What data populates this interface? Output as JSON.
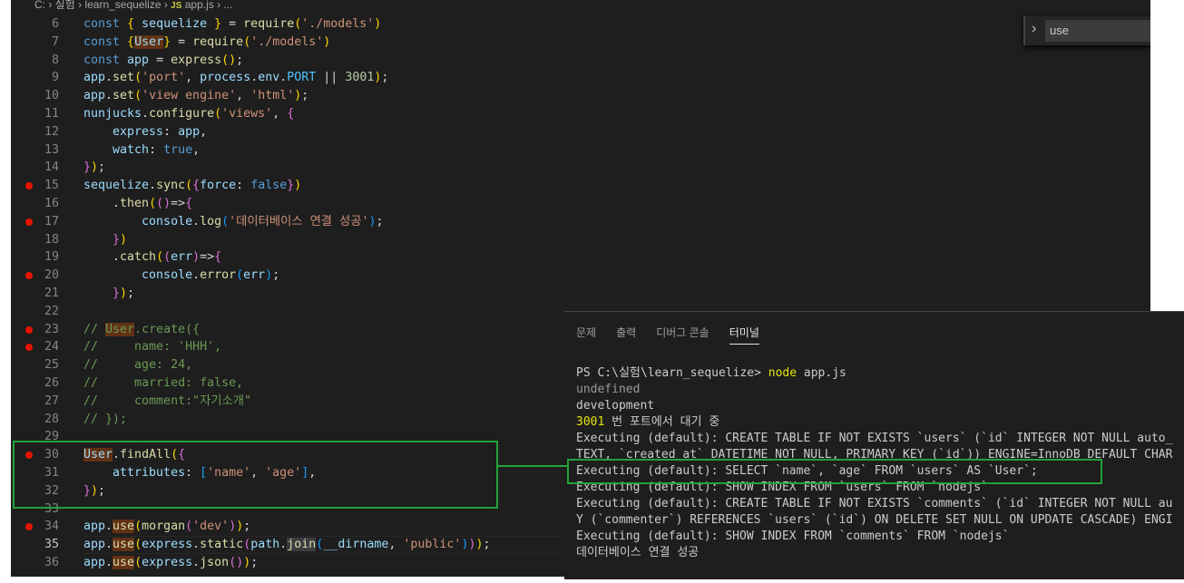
{
  "breadcrumb": {
    "parts": [
      "C:",
      "실험",
      "learn_sequelize"
    ],
    "file_icon": "JS",
    "file": "app.js",
    "ellipsis": "..."
  },
  "find_widget": {
    "toggle_icon": "chevron-right-icon",
    "value": "use"
  },
  "editor": {
    "lines": [
      {
        "n": "6",
        "t": [
          [
            "const ",
            "k"
          ],
          [
            "{",
            "b1"
          ],
          [
            " sequelize ",
            "v"
          ],
          [
            "}",
            "b1"
          ],
          [
            " = ",
            ""
          ],
          [
            "require",
            "f"
          ],
          [
            "(",
            "b1"
          ],
          [
            "'./models'",
            "s"
          ],
          [
            ")",
            "b1"
          ]
        ]
      },
      {
        "n": "7",
        "t": [
          [
            "const ",
            "k"
          ],
          [
            "{",
            "b1"
          ],
          [
            "User",
            "v hl"
          ],
          [
            "}",
            "b1"
          ],
          [
            " = ",
            ""
          ],
          [
            "require",
            "f"
          ],
          [
            "(",
            "b1"
          ],
          [
            "'./models'",
            "s"
          ],
          [
            ")",
            "b1"
          ]
        ]
      },
      {
        "n": "8",
        "t": [
          [
            "const ",
            "k"
          ],
          [
            "app",
            "v"
          ],
          [
            " = ",
            ""
          ],
          [
            "express",
            "f"
          ],
          [
            "()",
            "b1"
          ],
          [
            ";",
            ""
          ]
        ]
      },
      {
        "n": "9",
        "t": [
          [
            "app",
            "v"
          ],
          [
            ".",
            ""
          ],
          [
            "set",
            "f"
          ],
          [
            "(",
            "b1"
          ],
          [
            "'port'",
            "s"
          ],
          [
            ", ",
            ""
          ],
          [
            "process",
            "v"
          ],
          [
            ".",
            ""
          ],
          [
            "env",
            "v"
          ],
          [
            ".",
            ""
          ],
          [
            "PORT",
            "cn"
          ],
          [
            " || ",
            ""
          ],
          [
            "3001",
            "n"
          ],
          [
            ")",
            "b1"
          ],
          [
            ";",
            ""
          ]
        ]
      },
      {
        "n": "10",
        "t": [
          [
            "app",
            "v"
          ],
          [
            ".",
            ""
          ],
          [
            "set",
            "f"
          ],
          [
            "(",
            "b1"
          ],
          [
            "'view engine'",
            "s"
          ],
          [
            ", ",
            ""
          ],
          [
            "'html'",
            "s"
          ],
          [
            ")",
            "b1"
          ],
          [
            ";",
            ""
          ]
        ]
      },
      {
        "n": "11",
        "t": [
          [
            "nunjucks",
            "v"
          ],
          [
            ".",
            ""
          ],
          [
            "configure",
            "f"
          ],
          [
            "(",
            "b1"
          ],
          [
            "'views'",
            "s"
          ],
          [
            ", ",
            ""
          ],
          [
            "{",
            "b2"
          ]
        ]
      },
      {
        "n": "12",
        "t": [
          [
            "    express",
            "v"
          ],
          [
            ": ",
            ""
          ],
          [
            "app",
            "v"
          ],
          [
            ",",
            ""
          ]
        ]
      },
      {
        "n": "13",
        "t": [
          [
            "    watch",
            "v"
          ],
          [
            ": ",
            ""
          ],
          [
            "true",
            "k"
          ],
          [
            ",",
            ""
          ]
        ]
      },
      {
        "n": "14",
        "t": [
          [
            "}",
            "b2"
          ],
          [
            ")",
            "b1"
          ],
          [
            ";",
            ""
          ]
        ]
      },
      {
        "n": "15",
        "bp": true,
        "t": [
          [
            "sequelize",
            "v"
          ],
          [
            ".",
            ""
          ],
          [
            "sync",
            "f"
          ],
          [
            "(",
            "b1"
          ],
          [
            "{",
            "b2"
          ],
          [
            "force",
            "v"
          ],
          [
            ": ",
            ""
          ],
          [
            "false",
            "k"
          ],
          [
            "}",
            "b2"
          ],
          [
            ")",
            "b1"
          ]
        ]
      },
      {
        "n": "16",
        "t": [
          [
            "    .",
            ""
          ],
          [
            "then",
            "f"
          ],
          [
            "(",
            "b1"
          ],
          [
            "()",
            "b2"
          ],
          [
            "=>",
            ""
          ],
          [
            "{",
            "b2"
          ]
        ]
      },
      {
        "n": "17",
        "bp": true,
        "t": [
          [
            "        console",
            "v"
          ],
          [
            ".",
            ""
          ],
          [
            "log",
            "f"
          ],
          [
            "(",
            "b3"
          ],
          [
            "'데이터베이스 연결 성공'",
            "s"
          ],
          [
            ")",
            "b3"
          ],
          [
            ";",
            ""
          ]
        ]
      },
      {
        "n": "18",
        "t": [
          [
            "    ",
            ""
          ],
          [
            "}",
            "b2"
          ],
          [
            ")",
            "b1"
          ]
        ]
      },
      {
        "n": "19",
        "t": [
          [
            "    .",
            ""
          ],
          [
            "catch",
            "f"
          ],
          [
            "(",
            "b1"
          ],
          [
            "(",
            "b2"
          ],
          [
            "err",
            "v"
          ],
          [
            ")",
            "b2"
          ],
          [
            "=>",
            ""
          ],
          [
            "{",
            "b2"
          ]
        ]
      },
      {
        "n": "20",
        "bp": true,
        "t": [
          [
            "        console",
            "v"
          ],
          [
            ".",
            ""
          ],
          [
            "error",
            "f"
          ],
          [
            "(",
            "b3"
          ],
          [
            "err",
            "v"
          ],
          [
            ")",
            "b3"
          ],
          [
            ";",
            ""
          ]
        ]
      },
      {
        "n": "21",
        "t": [
          [
            "    ",
            ""
          ],
          [
            "}",
            "b2"
          ],
          [
            ")",
            "b1"
          ],
          [
            ";",
            ""
          ]
        ]
      },
      {
        "n": "22",
        "t": []
      },
      {
        "n": "23",
        "bp": true,
        "t": [
          [
            "// ",
            "c"
          ],
          [
            "User",
            "c hl"
          ],
          [
            ".create({",
            "c"
          ]
        ]
      },
      {
        "n": "24",
        "bp": true,
        "t": [
          [
            "//     name: 'HHH',",
            "c"
          ]
        ]
      },
      {
        "n": "25",
        "t": [
          [
            "//     age: 24,",
            "c"
          ]
        ]
      },
      {
        "n": "26",
        "t": [
          [
            "//     married: false,",
            "c"
          ]
        ]
      },
      {
        "n": "27",
        "t": [
          [
            "//     comment:\"자기소개\"",
            "c"
          ]
        ]
      },
      {
        "n": "28",
        "t": [
          [
            "// });",
            "c"
          ]
        ]
      },
      {
        "n": "29",
        "t": []
      },
      {
        "n": "30",
        "bp": true,
        "t": [
          [
            "User",
            "v hl"
          ],
          [
            ".",
            ""
          ],
          [
            "findAll",
            "f"
          ],
          [
            "(",
            "b1"
          ],
          [
            "{",
            "b2"
          ]
        ]
      },
      {
        "n": "31",
        "t": [
          [
            "    attributes",
            "v"
          ],
          [
            ": ",
            ""
          ],
          [
            "[",
            "b3"
          ],
          [
            "'name'",
            "s"
          ],
          [
            ", ",
            ""
          ],
          [
            "'age'",
            "s"
          ],
          [
            "]",
            "b3"
          ],
          [
            ",",
            ""
          ]
        ]
      },
      {
        "n": "32",
        "t": [
          [
            "}",
            "b2"
          ],
          [
            ")",
            "b1"
          ],
          [
            ";",
            ""
          ]
        ]
      },
      {
        "n": "33",
        "t": []
      },
      {
        "n": "34",
        "bp": true,
        "t": [
          [
            "app",
            "v"
          ],
          [
            ".",
            ""
          ],
          [
            "use",
            "f hl"
          ],
          [
            "(",
            "b1"
          ],
          [
            "morgan",
            "f"
          ],
          [
            "(",
            "b2"
          ],
          [
            "'dev'",
            "s"
          ],
          [
            ")",
            "b2"
          ],
          [
            ")",
            "b1"
          ],
          [
            ";",
            ""
          ]
        ]
      },
      {
        "n": "35",
        "cur": true,
        "t": [
          [
            "app",
            "v"
          ],
          [
            ".",
            ""
          ],
          [
            "use",
            "f hl"
          ],
          [
            "(",
            "b1"
          ],
          [
            "express",
            "v"
          ],
          [
            ".",
            ""
          ],
          [
            "static",
            "f"
          ],
          [
            "(",
            "b2"
          ],
          [
            "path",
            "v"
          ],
          [
            ".",
            ""
          ],
          [
            "join",
            "f gr"
          ],
          [
            "(",
            "b3"
          ],
          [
            "__dirname",
            "v"
          ],
          [
            ", ",
            ""
          ],
          [
            "'public'",
            "s"
          ],
          [
            ")",
            "b3"
          ],
          [
            ")",
            "b2"
          ],
          [
            ")",
            "b1"
          ],
          [
            ";",
            ""
          ]
        ]
      },
      {
        "n": "36",
        "t": [
          [
            "app",
            "v"
          ],
          [
            ".",
            ""
          ],
          [
            "use",
            "f hl"
          ],
          [
            "(",
            "b1"
          ],
          [
            "express",
            "v"
          ],
          [
            ".",
            ""
          ],
          [
            "json",
            "f"
          ],
          [
            "()",
            "b2"
          ],
          [
            ")",
            "b1"
          ],
          [
            ";",
            ""
          ]
        ]
      }
    ]
  },
  "panel": {
    "tabs": [
      "문제",
      "출력",
      "디버그 콘솔",
      "터미널"
    ],
    "active_tab": 3,
    "terminal_lines": [
      [
        [
          "PS C:\\실험\\learn_sequelize> ",
          ""
        ],
        [
          "node",
          "y"
        ],
        [
          " app.js",
          ""
        ]
      ],
      [
        [
          "undefined",
          "dim"
        ]
      ],
      [
        [
          "development",
          ""
        ]
      ],
      [
        [
          "3001",
          "y"
        ],
        [
          " 번 포트에서 대기 중",
          ""
        ]
      ],
      [
        [
          "Executing (default): CREATE TABLE IF NOT EXISTS `users` (`id` INTEGER NOT NULL auto_",
          ""
        ]
      ],
      [
        [
          "TEXT, `created_at` DATETIME NOT NULL, PRIMARY KEY (`id`)) ENGINE=InnoDB DEFAULT CHAR",
          ""
        ]
      ],
      [
        [
          "Executing (default): SELECT `name`, `age` FROM `users` AS `User`;",
          ""
        ]
      ],
      [
        [
          "Executing (default): SHOW INDEX FROM `users` FROM `nodejs`",
          ""
        ]
      ],
      [
        [
          "Executing (default): CREATE TABLE IF NOT EXISTS `comments` (`id` INTEGER NOT NULL au",
          ""
        ]
      ],
      [
        [
          "Y (`commenter`) REFERENCES `users` (`id`) ON DELETE SET NULL ON UPDATE CASCADE) ENGI",
          ""
        ]
      ],
      [
        [
          "Executing (default): SHOW INDEX FROM `comments` FROM `nodejs`",
          ""
        ]
      ],
      [
        [
          "데이터베이스 연결 성공",
          ""
        ]
      ]
    ]
  },
  "colors": {
    "annotation": "#22a23a",
    "breakpoint": "#e51400"
  }
}
